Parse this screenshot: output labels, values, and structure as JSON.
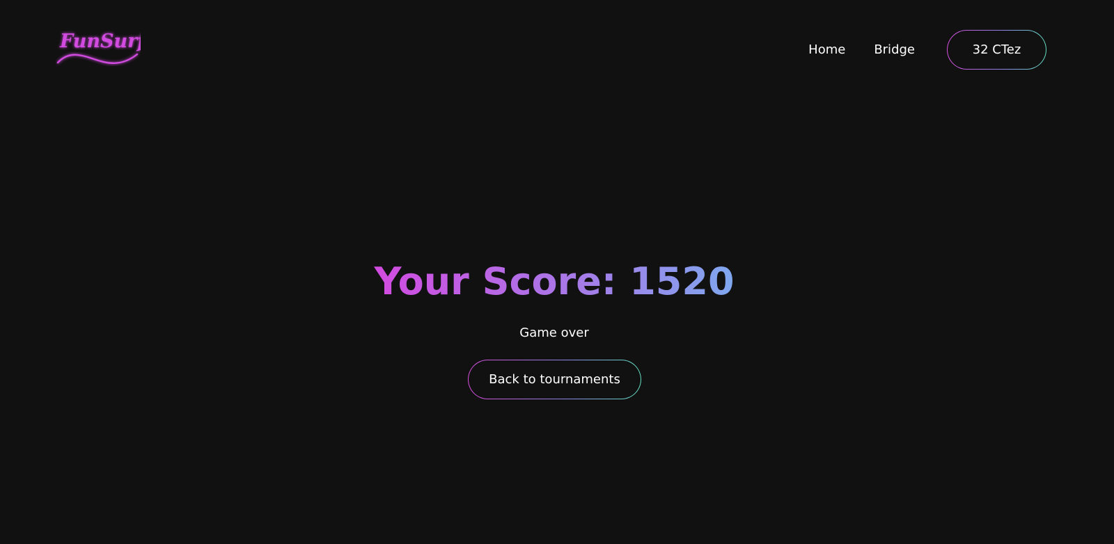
{
  "header": {
    "logo_text": "FunSurf",
    "nav": {
      "home_label": "Home",
      "bridge_label": "Bridge"
    },
    "balance_label": "32 CTez"
  },
  "main": {
    "score_label": "Your Score:",
    "score_value": "1520",
    "status_text": "Game over",
    "back_button_label": "Back to tournaments"
  },
  "colors": {
    "background": "#111111",
    "logo_neon": "#d24be0",
    "gradient_start": "#d24be0",
    "gradient_mid": "#a879e8",
    "gradient_end": "#7fa7ee",
    "button_border_end": "#62e0c2",
    "text": "#ffffff"
  },
  "icons": {
    "logo": "funsurf-neon-wave-logo"
  }
}
